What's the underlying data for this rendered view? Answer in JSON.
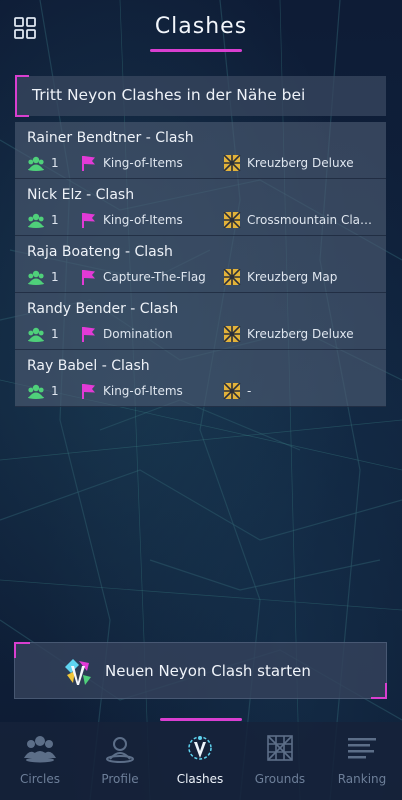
{
  "header": {
    "title": "Clashes"
  },
  "banner": {
    "text": "Tritt Neyon Clashes in der Nähe bei"
  },
  "clashes": [
    {
      "name": "Rainer Bendtner - Clash",
      "players": "1",
      "mode": "King-of-Items",
      "map": "Kreuzberg Deluxe"
    },
    {
      "name": "Nick Elz - Clash",
      "players": "1",
      "mode": "King-of-Items",
      "map": "Crossmountain Clas..."
    },
    {
      "name": "Raja Boateng - Clash",
      "players": "1",
      "mode": "Capture-The-Flag",
      "map": "Kreuzberg Map"
    },
    {
      "name": "Randy Bender - Clash",
      "players": "1",
      "mode": "Domination",
      "map": "Kreuzberg Deluxe"
    },
    {
      "name": "Ray Babel - Clash",
      "players": "1",
      "mode": "King-of-Items",
      "map": "-"
    }
  ],
  "start_button": {
    "label": "Neuen Neyon Clash starten"
  },
  "nav": {
    "items": [
      {
        "label": "Circles",
        "icon": "circles-icon"
      },
      {
        "label": "Profile",
        "icon": "profile-icon"
      },
      {
        "label": "Clashes",
        "icon": "clashes-icon"
      },
      {
        "label": "Grounds",
        "icon": "grounds-icon"
      },
      {
        "label": "Ranking",
        "icon": "ranking-icon"
      }
    ],
    "active": "Clashes"
  },
  "colors": {
    "accent": "#d93fd0",
    "players_icon": "#4fd07a",
    "flag_icon": "#e23ad6",
    "map_icon": "#e2b23a"
  }
}
